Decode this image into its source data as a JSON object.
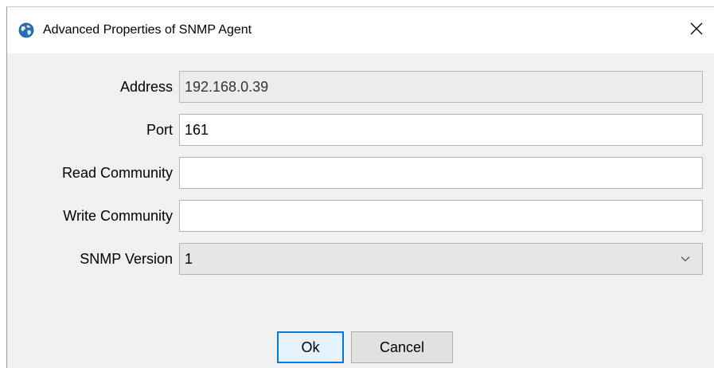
{
  "window": {
    "title": "Advanced Properties of SNMP Agent",
    "icon": "globe-icon",
    "close_label": "✕"
  },
  "form": {
    "address": {
      "label": "Address",
      "value": "192.168.0.39"
    },
    "port": {
      "label": "Port",
      "value": "161"
    },
    "read_community": {
      "label": "Read Community",
      "value": ""
    },
    "write_community": {
      "label": "Write Community",
      "value": ""
    },
    "snmp_version": {
      "label": "SNMP Version",
      "selected": "1"
    }
  },
  "buttons": {
    "ok_label": "Ok",
    "cancel_label": "Cancel"
  },
  "colors": {
    "default_button_border": "#0078d7",
    "dialog_background": "#f0f0f0"
  }
}
